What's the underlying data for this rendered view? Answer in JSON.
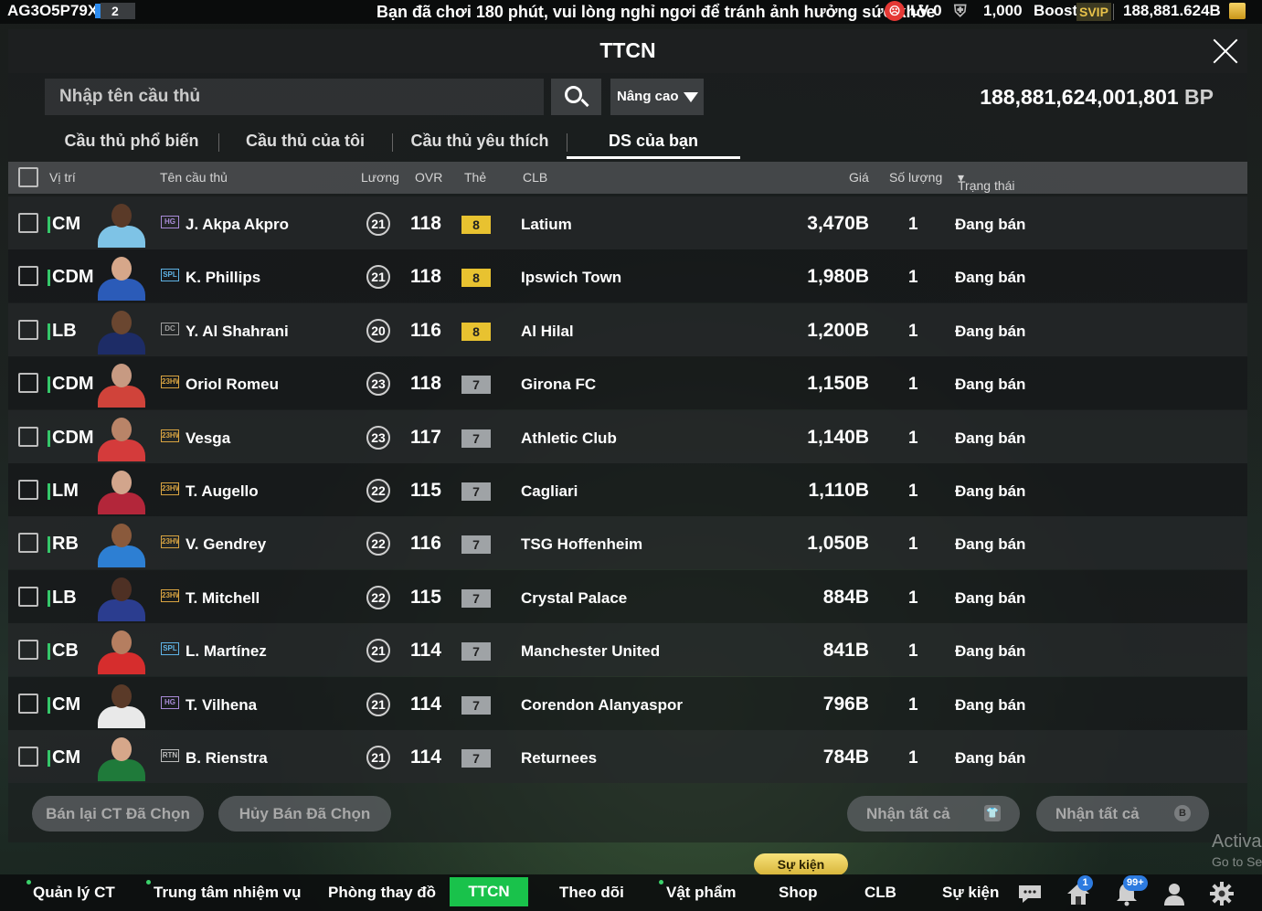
{
  "topbar": {
    "user_id": "AG3O5P79X",
    "user_count": "2",
    "notice": "Bạn đã chơi 180 phút, vui lòng nghỉ ngơi để tránh ảnh hưởng sức khỏe",
    "level": "LV 0",
    "fans": "1,000",
    "boost": "Boost",
    "svip": "SVIP",
    "money": "188,881.624B"
  },
  "header": {
    "title": "TTCN"
  },
  "search": {
    "placeholder": "Nhập tên cầu thủ",
    "advanced_label": "Nâng cao"
  },
  "balance": {
    "amount": "188,881,624,001,801",
    "unit": "BP"
  },
  "tabs": [
    {
      "label": "Cầu thủ phổ biến"
    },
    {
      "label": "Cầu thủ của tôi"
    },
    {
      "label": "Cầu thủ yêu thích"
    },
    {
      "label": "DS của bạn",
      "active": true
    }
  ],
  "columns": {
    "position": "Vị trí",
    "name": "Tên cầu thủ",
    "salary": "Lương",
    "ovr": "OVR",
    "grade": "Thẻ",
    "club": "CLB",
    "price": "Giá",
    "qty": "Số lượng",
    "status": "Trạng thái"
  },
  "players": [
    {
      "pos": "CM",
      "season": "HG",
      "name": "J. Akpa Akpro",
      "salary": "21",
      "ovr": "118",
      "grade": "8",
      "club": "Latium",
      "price": "3,470B",
      "qty": "1",
      "status": "Đang bán",
      "season_color": "#a98bd8",
      "kit": "#7ec3e6",
      "skin": "#5a3a28"
    },
    {
      "pos": "CDM",
      "season": "SPL",
      "name": "K. Phillips",
      "salary": "21",
      "ovr": "118",
      "grade": "8",
      "club": "Ipswich Town",
      "price": "1,980B",
      "qty": "1",
      "status": "Đang bán",
      "season_color": "#5fb3e6",
      "kit": "#2b5bb8",
      "skin": "#d6a78a"
    },
    {
      "pos": "LB",
      "season": "DC",
      "name": "Y. Al Shahrani",
      "salary": "20",
      "ovr": "116",
      "grade": "8",
      "club": "Al Hilal",
      "price": "1,200B",
      "qty": "1",
      "status": "Đang bán",
      "season_color": "#9e9e9e",
      "kit": "#1d2c66",
      "skin": "#6a4630"
    },
    {
      "pos": "CDM",
      "season": "23HW",
      "name": "Oriol Romeu",
      "salary": "23",
      "ovr": "118",
      "grade": "7",
      "club": "Girona FC",
      "price": "1,150B",
      "qty": "1",
      "status": "Đang bán",
      "season_color": "#d9a441",
      "kit": "#d0433a",
      "skin": "#c79a82"
    },
    {
      "pos": "CDM",
      "season": "23HW",
      "name": "Vesga",
      "salary": "23",
      "ovr": "117",
      "grade": "7",
      "club": "Athletic Club",
      "price": "1,140B",
      "qty": "1",
      "status": "Đang bán",
      "season_color": "#d9a441",
      "kit": "#d43b3b",
      "skin": "#b98468"
    },
    {
      "pos": "LM",
      "season": "23HW",
      "name": "T. Augello",
      "salary": "22",
      "ovr": "115",
      "grade": "7",
      "club": "Cagliari",
      "price": "1,110B",
      "qty": "1",
      "status": "Đang bán",
      "season_color": "#d9a441",
      "kit": "#b3263a",
      "skin": "#d2a58c"
    },
    {
      "pos": "RB",
      "season": "23HW",
      "name": "V. Gendrey",
      "salary": "22",
      "ovr": "116",
      "grade": "7",
      "club": "TSG Hoffenheim",
      "price": "1,050B",
      "qty": "1",
      "status": "Đang bán",
      "season_color": "#d9a441",
      "kit": "#2d7fd3",
      "skin": "#8a5a3c"
    },
    {
      "pos": "LB",
      "season": "23HW",
      "name": "T. Mitchell",
      "salary": "22",
      "ovr": "115",
      "grade": "7",
      "club": "Crystal Palace",
      "price": "884B",
      "qty": "1",
      "status": "Đang bán",
      "season_color": "#d9a441",
      "kit": "#2b3d8f",
      "skin": "#4e3024"
    },
    {
      "pos": "CB",
      "season": "SPL",
      "name": "L. Martínez",
      "salary": "21",
      "ovr": "114",
      "grade": "7",
      "club": "Manchester United",
      "price": "841B",
      "qty": "1",
      "status": "Đang bán",
      "season_color": "#5fb3e6",
      "kit": "#d62d2d",
      "skin": "#b57e60"
    },
    {
      "pos": "CM",
      "season": "HG",
      "name": "T. Vilhena",
      "salary": "21",
      "ovr": "114",
      "grade": "7",
      "club": "Corendon Alanyaspor",
      "price": "796B",
      "qty": "1",
      "status": "Đang bán",
      "season_color": "#a98bd8",
      "kit": "#e9e9e9",
      "skin": "#5a3a28"
    },
    {
      "pos": "CM",
      "season": "RTN",
      "name": "B. Rienstra",
      "salary": "21",
      "ovr": "114",
      "grade": "7",
      "club": "Returnees",
      "price": "784B",
      "qty": "1",
      "status": "Đang bán",
      "season_color": "#bdbdbd",
      "kit": "#1f7a3a",
      "skin": "#d6a78a"
    }
  ],
  "grade_colors": {
    "8": "#e8c230",
    "7": "#9fa3a6"
  },
  "actions": {
    "resell": "Bán lại CT Đã Chọn",
    "cancel_sale": "Hủy Bán Đã Chọn",
    "claim_all_1": "Nhận tất cả",
    "claim_all_2": "Nhận tất cả"
  },
  "bottom_nav": {
    "manage": "Quản lý CT",
    "missions": "Trung tâm nhiệm vụ",
    "locker": "Phòng thay đồ",
    "market": "TTCN",
    "follow": "Theo dõi",
    "items": "Vật phẩm",
    "shop": "Shop",
    "club": "CLB",
    "events": "Sự kiện",
    "event_badge": "Sự kiện",
    "mail_badge": "1",
    "notif_badge": "99+"
  },
  "watermark": {
    "line1": "Activa",
    "line2": "Go to Se"
  },
  "accent_color": "#19c24b"
}
